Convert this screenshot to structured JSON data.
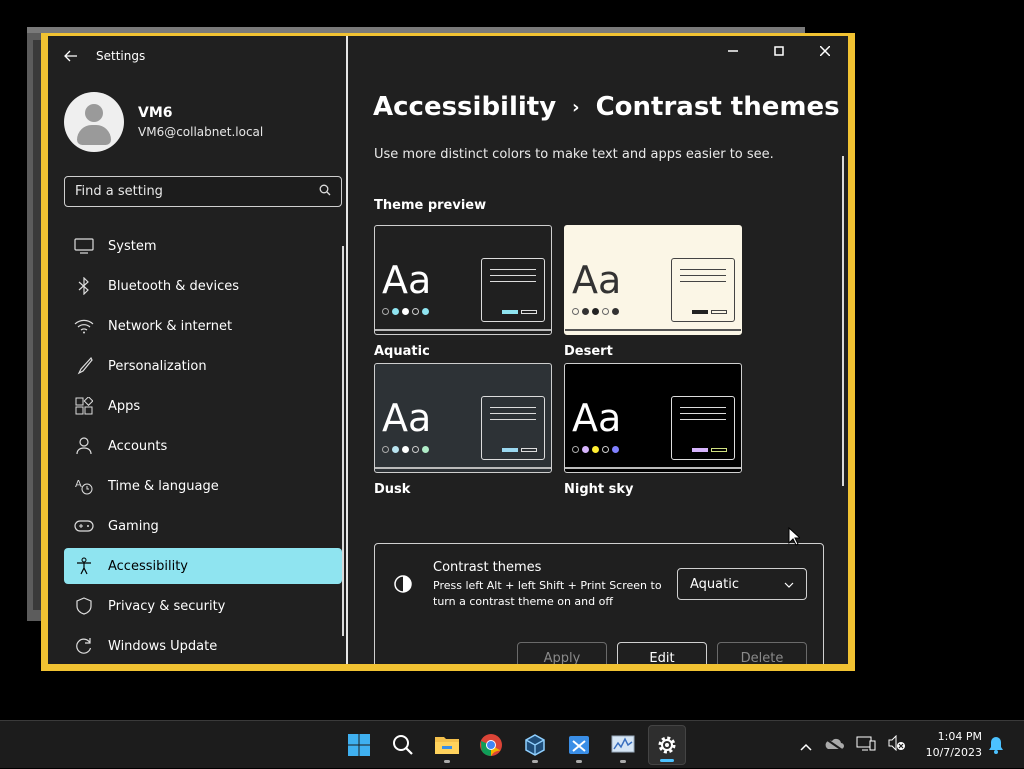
{
  "window": {
    "app_title": "Settings"
  },
  "profile": {
    "name": "VM6",
    "email": "VM6@collabnet.local"
  },
  "search": {
    "placeholder": "Find a setting"
  },
  "nav": {
    "items": [
      {
        "label": "System",
        "icon": "monitor-icon"
      },
      {
        "label": "Bluetooth & devices",
        "icon": "bluetooth-icon"
      },
      {
        "label": "Network & internet",
        "icon": "wifi-icon"
      },
      {
        "label": "Personalization",
        "icon": "brush-icon"
      },
      {
        "label": "Apps",
        "icon": "apps-icon"
      },
      {
        "label": "Accounts",
        "icon": "person-icon"
      },
      {
        "label": "Time & language",
        "icon": "time-language-icon"
      },
      {
        "label": "Gaming",
        "icon": "gamepad-icon"
      },
      {
        "label": "Accessibility",
        "icon": "accessibility-icon",
        "active": true
      },
      {
        "label": "Privacy & security",
        "icon": "shield-icon"
      },
      {
        "label": "Windows Update",
        "icon": "update-icon"
      }
    ]
  },
  "main": {
    "breadcrumb_parent": "Accessibility",
    "breadcrumb_separator": "›",
    "breadcrumb_current": "Contrast themes",
    "description": "Use more distinct colors to make text and apps easier to see.",
    "preview_label": "Theme preview",
    "themes": [
      {
        "name": "Aquatic",
        "sample": "Aa"
      },
      {
        "name": "Desert",
        "sample": "Aa"
      },
      {
        "name": "Dusk",
        "sample": "Aa"
      },
      {
        "name": "Night sky",
        "sample": "Aa"
      }
    ],
    "card": {
      "title": "Contrast themes",
      "description": "Press left Alt + left Shift + Print Screen to turn a contrast theme on and off",
      "selected_theme": "Aquatic",
      "apply_label": "Apply",
      "edit_label": "Edit",
      "delete_label": "Delete"
    }
  },
  "taskbar": {
    "time": "1:04 PM",
    "date": "10/7/2023",
    "apps": [
      "windows-start-icon",
      "search-icon",
      "file-explorer-icon",
      "chrome-icon",
      "virtualbox-icon",
      "snipping-tool-icon",
      "resource-monitor-icon",
      "settings-icon"
    ]
  },
  "colors": {
    "accent_border": "#f1c232",
    "nav_active": "#8fe4f0",
    "window_bg": "#202020"
  }
}
